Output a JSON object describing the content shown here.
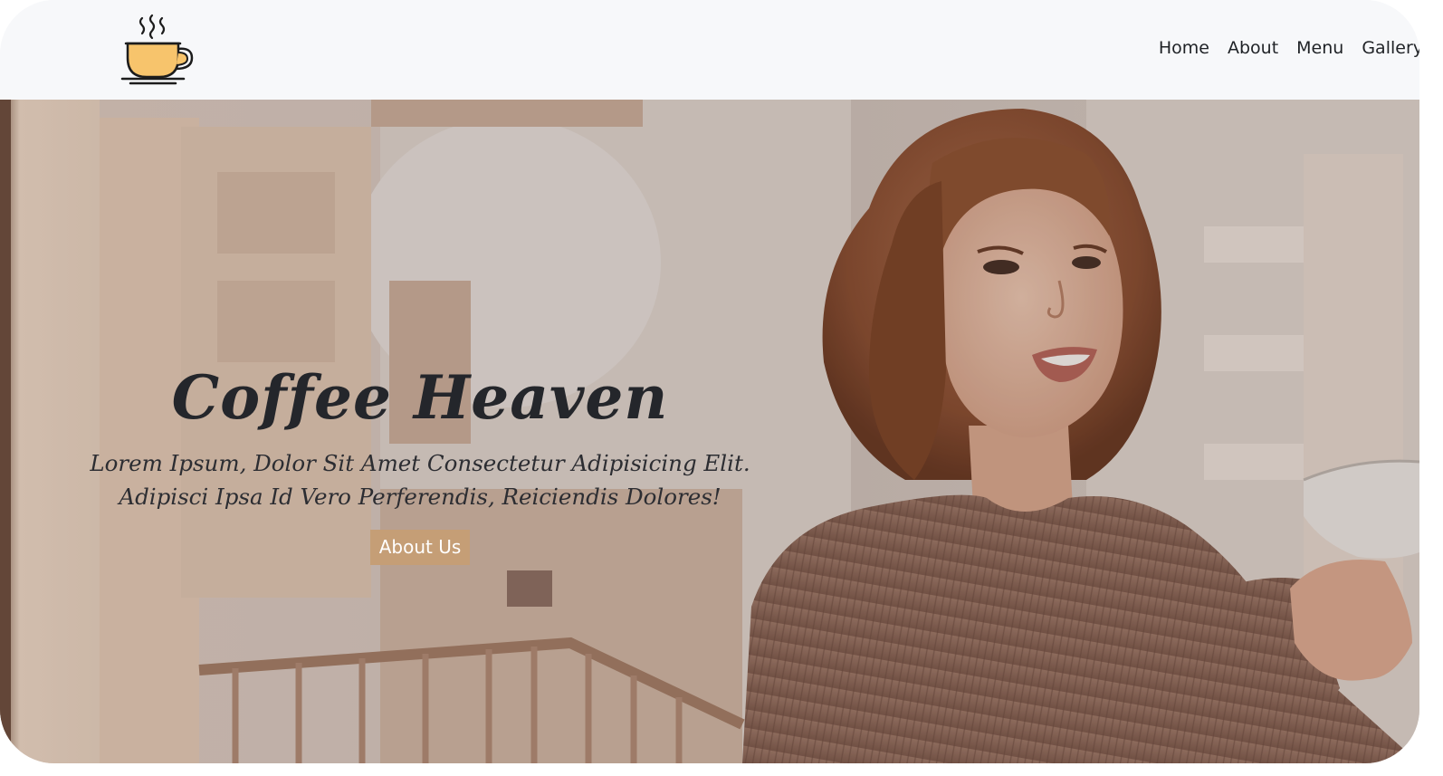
{
  "nav": {
    "logo_icon": "coffee-cup-icon",
    "links": [
      "Home",
      "About",
      "Menu",
      "Gallery"
    ]
  },
  "hero": {
    "title": "Coffee Heaven",
    "subtitle_line1": "Lorem Ipsum, Dolor Sit Amet Consectetur Adipisicing Elit.",
    "subtitle_line2": "Adipisci Ipsa Id Vero Perferendis, Reiciendis Dolores!",
    "button_label": "About Us",
    "background_image": "woman-holding-coffee-cup-on-balcony"
  },
  "colors": {
    "nav_bg": "#f7f8fa",
    "button_bg": "#c59e76",
    "logo_cup": "#f7c46c",
    "text_dark": "#24262b"
  }
}
